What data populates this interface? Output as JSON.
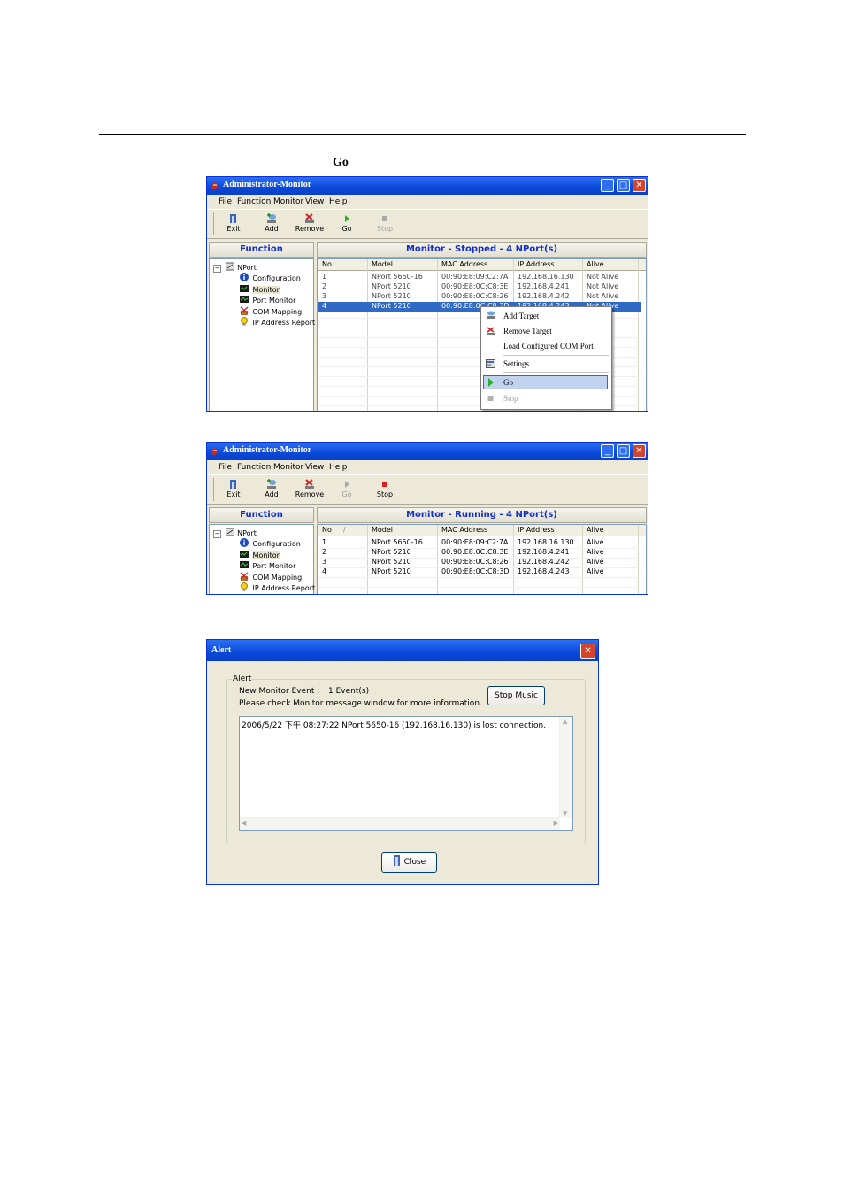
{
  "heading": "Go",
  "window1": {
    "title": "Administrator-Monitor",
    "menu": [
      "File",
      "Function",
      "Monitor",
      "View",
      "Help"
    ],
    "toolbar": [
      {
        "label": "Exit",
        "icon": "exit-icon",
        "enabled": true
      },
      {
        "label": "Add",
        "icon": "add-icon",
        "enabled": true
      },
      {
        "label": "Remove",
        "icon": "remove-icon",
        "enabled": true
      },
      {
        "label": "Go",
        "icon": "go-icon",
        "enabled": true
      },
      {
        "label": "Stop",
        "icon": "stop-icon",
        "enabled": false
      }
    ],
    "function_header": "Function",
    "tree": [
      "NPort",
      "Configuration",
      "Monitor",
      "Port Monitor",
      "COM Mapping",
      "IP Address Report"
    ],
    "list_header": "Monitor - Stopped - 4 NPort(s)",
    "columns": [
      "No",
      "Model",
      "MAC Address",
      "IP Address",
      "Alive"
    ],
    "rows": [
      [
        "1",
        "NPort 5650-16",
        "00:90:E8:09:C2:7A",
        "192.168.16.130",
        "Not Alive"
      ],
      [
        "2",
        "NPort 5210",
        "00:90:E8:0C:C8:3E",
        "192.168.4.241",
        "Not Alive"
      ],
      [
        "3",
        "NPort 5210",
        "00:90:E8:0C:C8:26",
        "192.168.4.242",
        "Not Alive"
      ],
      [
        "4",
        "NPort 5210",
        "00:90:E8:0C:C8:3D",
        "192.168.4.243",
        "Not Alive"
      ]
    ],
    "context_menu": [
      "Add Target",
      "Remove Target",
      "Load Configured COM Port",
      "Settings",
      "Go",
      "Stop"
    ]
  },
  "window2": {
    "title": "Administrator-Monitor",
    "menu": [
      "File",
      "Function",
      "Monitor",
      "View",
      "Help"
    ],
    "toolbar": [
      {
        "label": "Exit",
        "icon": "exit-icon",
        "enabled": true
      },
      {
        "label": "Add",
        "icon": "add-icon",
        "enabled": true
      },
      {
        "label": "Remove",
        "icon": "remove-icon",
        "enabled": true
      },
      {
        "label": "Go",
        "icon": "go-icon",
        "enabled": false
      },
      {
        "label": "Stop",
        "icon": "stop-icon",
        "enabled": true
      }
    ],
    "function_header": "Function",
    "tree": [
      "NPort",
      "Configuration",
      "Monitor",
      "Port Monitor",
      "COM Mapping",
      "IP Address Report"
    ],
    "list_header": "Monitor - Running - 4 NPort(s)",
    "columns": [
      "No",
      "Model",
      "MAC Address",
      "IP Address",
      "Alive"
    ],
    "rows": [
      [
        "1",
        "NPort 5650-16",
        "00:90:E8:09:C2:7A",
        "192.168.16.130",
        "Alive"
      ],
      [
        "2",
        "NPort 5210",
        "00:90:E8:0C:C8:3E",
        "192.168.4.241",
        "Alive"
      ],
      [
        "3",
        "NPort 5210",
        "00:90:E8:0C:C8:26",
        "192.168.4.242",
        "Alive"
      ],
      [
        "4",
        "NPort 5210",
        "00:90:E8:0C:C8:3D",
        "192.168.4.243",
        "Alive"
      ]
    ]
  },
  "alert": {
    "title": "Alert",
    "group_label": "Alert",
    "event_label": "New Monitor Event :",
    "event_count": "1 Event(s)",
    "instruction": "Please check Monitor message window for more information.",
    "stop_music_button": "Stop Music",
    "message": "2006/5/22 下午 08:27:22 NPort 5650-16 (192.168.16.130) is lost connection.",
    "close_button": "Close"
  },
  "colors": {
    "title_bar": "#0a48d8",
    "panel_header_text": "#1430c8",
    "selection": "#316ac5",
    "window_bg": "#ece9d8"
  }
}
